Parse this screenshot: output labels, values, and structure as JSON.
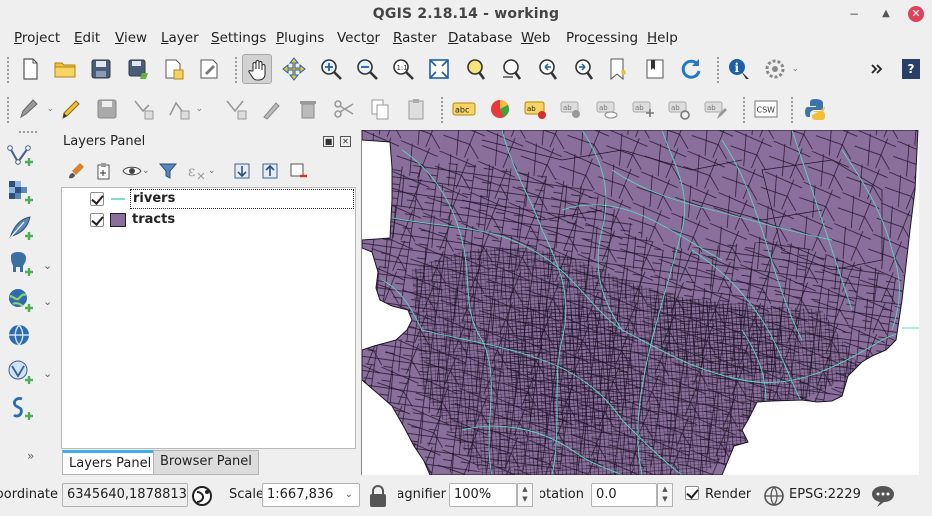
{
  "window": {
    "title": "QGIS 2.18.14 - working"
  },
  "menubar": {
    "items": [
      {
        "label": "Project",
        "u": "P",
        "rest": "roject"
      },
      {
        "label": "Edit",
        "u": "E",
        "rest": "dit"
      },
      {
        "label": "View",
        "u": "V",
        "rest": "iew"
      },
      {
        "label": "Layer",
        "u": "L",
        "rest": "ayer"
      },
      {
        "label": "Settings",
        "u": "S",
        "rest": "ettings"
      },
      {
        "label": "Plugins",
        "u": "P",
        "rest": "lugins"
      },
      {
        "label": "Vector",
        "pre": "Vect",
        "u": "o",
        "rest": "r"
      },
      {
        "label": "Raster",
        "u": "R",
        "rest": "aster"
      },
      {
        "label": "Database",
        "u": "D",
        "rest": "atabase"
      },
      {
        "label": "Web",
        "u": "W",
        "rest": "eb"
      },
      {
        "label": "Processing",
        "pre": "Pro",
        "u": "c",
        "rest": "essing"
      },
      {
        "label": "Help",
        "u": "H",
        "rest": "elp"
      }
    ]
  },
  "layers_panel": {
    "title": "Layers Panel",
    "layers": [
      {
        "name": "rivers",
        "checked": true,
        "symbol": "line",
        "color": "#5fd3c0"
      },
      {
        "name": "tracts",
        "checked": true,
        "symbol": "fill",
        "color": "#8a6e9c"
      }
    ],
    "tabs": [
      {
        "label": "Layers Panel",
        "active": true
      },
      {
        "label": "Browser Panel",
        "active": false
      }
    ]
  },
  "map": {
    "fill_color": "#8a6e9c",
    "stroke_color": "#1e1428",
    "river_color": "#5fd3c0"
  },
  "statusbar": {
    "coordinate_label": "Coordinate",
    "coordinate_value": "6345640,1878813",
    "scale_label": "Scale",
    "scale_value": "1:667,836",
    "magnifier_label": "Magnifier",
    "magnifier_value": "100%",
    "rotation_label": "Rotation",
    "rotation_value": "0.0",
    "render_label": "Render",
    "crs_label": "EPSG:2229"
  }
}
